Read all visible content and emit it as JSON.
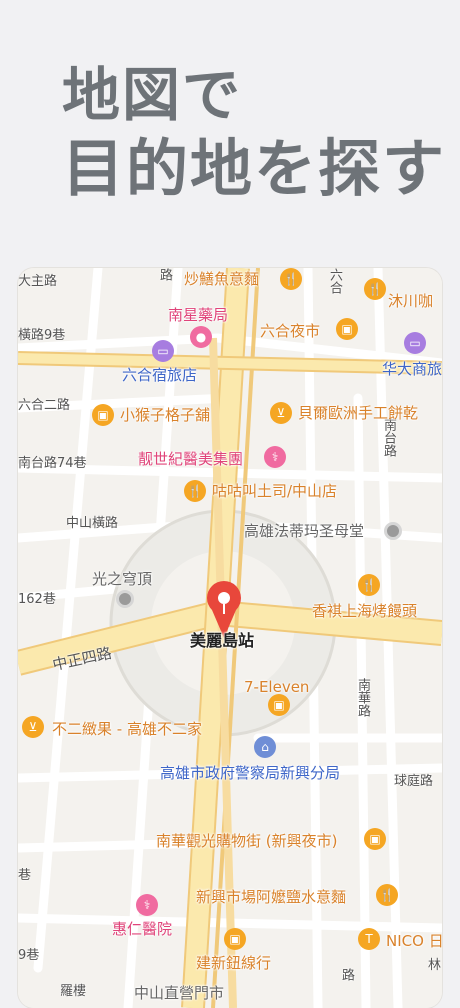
{
  "heading": {
    "line1": "地図で",
    "line2": "目的地を探す"
  },
  "map": {
    "station": "美麗島站",
    "pois": [
      {
        "label": "炒鱔魚意麵",
        "icon": "fork-knife-icon",
        "color": "orange"
      },
      {
        "label": "沐川咖",
        "icon": "fork-knife-icon",
        "color": "orange"
      },
      {
        "label": "南星藥局",
        "icon": "pill-icon",
        "color": "pink"
      },
      {
        "label": "六合夜市",
        "icon": "shopping-bag-icon",
        "color": "orange"
      },
      {
        "label": "六合宿旅店",
        "icon": "bed-icon",
        "color": "purple"
      },
      {
        "label": "华大商旅",
        "icon": "bed-icon",
        "color": "purple"
      },
      {
        "label": "小猴子格子舖",
        "icon": "shopping-bag-icon",
        "color": "orange"
      },
      {
        "label": "貝爾歐洲手工餅乾",
        "icon": "basket-icon",
        "color": "orange"
      },
      {
        "label": "靓世紀醫美集團",
        "icon": "stethoscope-icon",
        "color": "pink"
      },
      {
        "label": "咕咕叫土司/中山店",
        "icon": "fork-knife-icon",
        "color": "orange"
      },
      {
        "label": "高雄法蒂玛圣母堂",
        "icon": "",
        "color": "grey"
      },
      {
        "label": "光之穹頂",
        "icon": "",
        "color": "grey"
      },
      {
        "label": "香褀上海烤饅頭",
        "icon": "fork-knife-icon",
        "color": "orange"
      },
      {
        "label": "7-Eleven",
        "icon": "shopping-bag-icon",
        "color": "orange"
      },
      {
        "label": "不二緻果 - 高雄不二家",
        "icon": "basket-icon",
        "color": "orange"
      },
      {
        "label": "高雄市政府警察局新興分局",
        "icon": "government-icon",
        "color": "blue"
      },
      {
        "label": "南華觀光購物街 (新興夜市)",
        "icon": "shopping-bag-icon",
        "color": "orange"
      },
      {
        "label": "新興市場阿嬤鹽水意麵",
        "icon": "fork-knife-icon",
        "color": "orange"
      },
      {
        "label": "惠仁醫院",
        "icon": "stethoscope-icon",
        "color": "pink"
      },
      {
        "label": "NICO 日",
        "icon": "shirt-icon",
        "color": "orange"
      },
      {
        "label": "建新鈕線行",
        "icon": "shopping-bag-icon",
        "color": "orange"
      },
      {
        "label": "中山直營門市",
        "icon": "",
        "color": "grey"
      }
    ],
    "roads": [
      "中正四路",
      "中山橫路",
      "六合二路",
      "六合",
      "南台路74巷",
      "南台路",
      "南華路",
      "球庭路",
      "162巷",
      "9巷",
      "橫路9巷",
      "大主路",
      "林",
      "路",
      "路",
      "羅樓",
      "巷"
    ],
    "colors": {
      "road_major": "#fbe7a7",
      "road_major_edge": "#f0c97a",
      "road_minor": "#ffffff",
      "land": "#f4f2ee",
      "pin": "#e8473b"
    }
  }
}
